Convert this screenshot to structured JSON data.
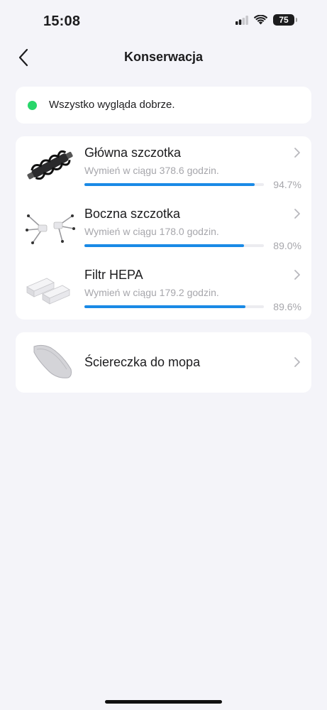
{
  "status_bar": {
    "time": "15:08",
    "battery": "75"
  },
  "nav": {
    "title": "Konserwacja"
  },
  "status": {
    "text": "Wszystko wygląda dobrze.",
    "color": "#28d66a"
  },
  "accent_color": "#1a8ae6",
  "parts": [
    {
      "name": "Główna szczotka",
      "subtitle": "Wymień w ciągu 378.6 godzin.",
      "percent_label": "94.7%",
      "progress": 94.7,
      "icon": "main-brush-icon"
    },
    {
      "name": "Boczna szczotka",
      "subtitle": "Wymień w ciągu 178.0 godzin.",
      "percent_label": "89.0%",
      "progress": 89.0,
      "icon": "side-brush-icon"
    },
    {
      "name": "Filtr HEPA",
      "subtitle": "Wymień w ciągu 179.2 godzin.",
      "percent_label": "89.6%",
      "progress": 89.6,
      "icon": "hepa-filter-icon"
    }
  ],
  "mop": {
    "name": "Ściereczka do mopa",
    "icon": "mop-cloth-icon"
  }
}
